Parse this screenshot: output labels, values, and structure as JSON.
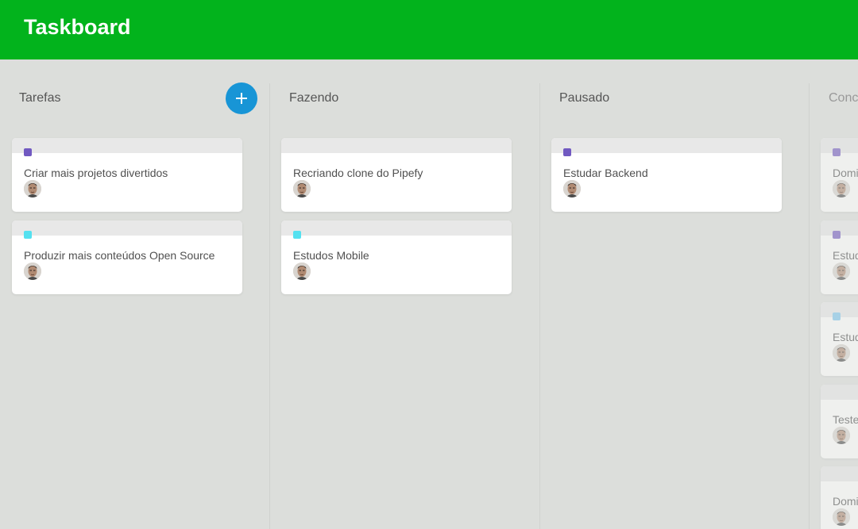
{
  "app": {
    "title": "Taskboard"
  },
  "colors": {
    "header": "#02b31c",
    "add_button": "#1895d6",
    "label_purple": "#7159c1",
    "label_cyan": "#54e1f0",
    "label_blue": "#7cc8f0"
  },
  "columns": [
    {
      "title": "Tarefas",
      "has_add_button": true,
      "add_icon": "plus-icon",
      "cards": [
        {
          "text": "Criar mais projetos divertidos",
          "label_color": "#7159c1"
        },
        {
          "text": "Produzir mais conteúdos Open Source",
          "label_color": "#54e1f0"
        }
      ]
    },
    {
      "title": "Fazendo",
      "cards": [
        {
          "text": "Recriando clone do Pipefy",
          "label_color": null
        },
        {
          "text": "Estudos Mobile",
          "label_color": "#54e1f0"
        }
      ]
    },
    {
      "title": "Pausado",
      "cards": [
        {
          "text": "Estudar Backend",
          "label_color": "#7159c1"
        }
      ]
    },
    {
      "title": "Conc",
      "cards": [
        {
          "text": "Domi",
          "label_color": "#7159c1"
        },
        {
          "text": "Estud",
          "label_color": "#7159c1"
        },
        {
          "text": "Estud",
          "label_color": "#7cc8f0"
        },
        {
          "text": "Teste",
          "label_color": null
        },
        {
          "text": "Domi",
          "label_color": null
        }
      ]
    }
  ]
}
